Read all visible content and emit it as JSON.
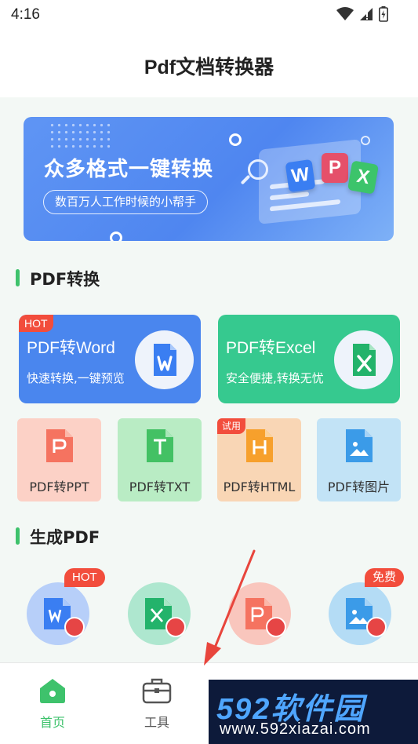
{
  "status_bar": {
    "time": "4:16"
  },
  "app": {
    "title": "Pdf文档转换器"
  },
  "banner": {
    "headline": "众多格式一键转换",
    "subtitle": "数百万人工作时候的小帮手",
    "tiles": [
      "W",
      "P",
      "X"
    ]
  },
  "pdf_convert": {
    "section_title": "PDF转换",
    "big_cards": [
      {
        "title": "PDF转Word",
        "subtitle": "快速转换,一键预览",
        "tag": "HOT",
        "color": "#4a86ee"
      },
      {
        "title": "PDF转Excel",
        "subtitle": "安全便捷,转换无忧",
        "color": "#36c98f"
      }
    ],
    "small_cards": [
      {
        "label": "PDF转PPT",
        "icon_letter": "P",
        "color": "#f57360"
      },
      {
        "label": "PDF转TXT",
        "icon_letter": "T",
        "color": "#43c164"
      },
      {
        "label": "PDF转HTML",
        "icon_letter": "H",
        "color": "#f7a02c",
        "tag": "试用"
      },
      {
        "label": "PDF转图片",
        "icon_letter": "",
        "color": "#3b9be8"
      }
    ]
  },
  "generate_pdf": {
    "section_title": "生成PDF",
    "tags": {
      "first": "HOT",
      "last": "免费"
    }
  },
  "tab_bar": {
    "tabs": [
      {
        "label": "首页",
        "active": true
      },
      {
        "label": "工具",
        "active": false
      }
    ]
  },
  "watermark": {
    "brand": "592软件园",
    "url": "www.592xiazai.com"
  },
  "colors": {
    "accent_green": "#3ec26c",
    "hot_red": "#f24d3c"
  }
}
